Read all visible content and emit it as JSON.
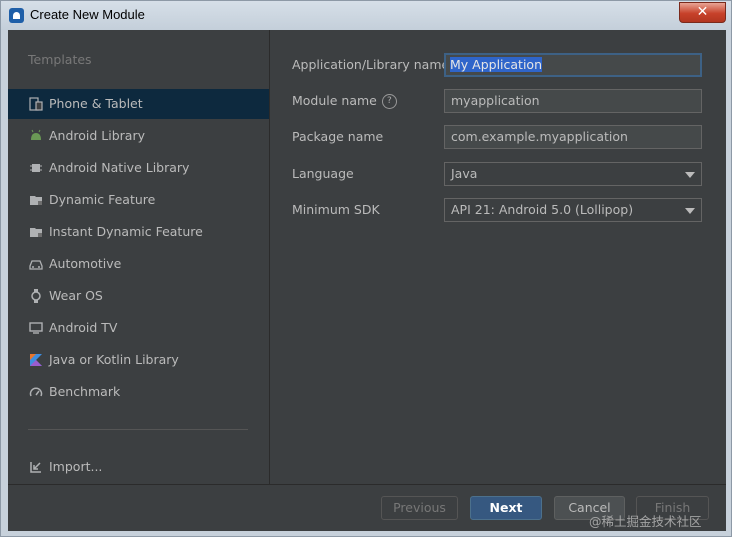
{
  "window": {
    "title": "Create New Module",
    "close_glyph": "✕"
  },
  "sidebar": {
    "heading": "Templates",
    "items": [
      {
        "label": "Phone & Tablet",
        "icon": "phone-tablet-icon"
      },
      {
        "label": "Android Library",
        "icon": "android-icon"
      },
      {
        "label": "Android Native Library",
        "icon": "chip-icon"
      },
      {
        "label": "Dynamic Feature",
        "icon": "folder-icon"
      },
      {
        "label": "Instant Dynamic Feature",
        "icon": "folder-icon"
      },
      {
        "label": "Automotive",
        "icon": "car-icon"
      },
      {
        "label": "Wear OS",
        "icon": "watch-icon"
      },
      {
        "label": "Android TV",
        "icon": "tv-icon"
      },
      {
        "label": "Java or Kotlin Library",
        "icon": "kotlin-icon"
      },
      {
        "label": "Benchmark",
        "icon": "gauge-icon"
      }
    ],
    "import_label": "Import..."
  },
  "form": {
    "app_name_label": "Application/Library name",
    "app_name_value": "My Application",
    "module_name_label": "Module name",
    "module_name_value": "myapplication",
    "package_name_label": "Package name",
    "package_name_value": "com.example.myapplication",
    "language_label": "Language",
    "language_value": "Java",
    "min_sdk_label": "Minimum SDK",
    "min_sdk_value": "API 21: Android 5.0 (Lollipop)"
  },
  "footer": {
    "previous": "Previous",
    "next": "Next",
    "cancel": "Cancel",
    "finish": "Finish"
  },
  "watermark": "@稀土掘金技术社区",
  "colors": {
    "selection": "#0d293e",
    "primary_button": "#365880",
    "text_selection": "#2f65ca"
  }
}
